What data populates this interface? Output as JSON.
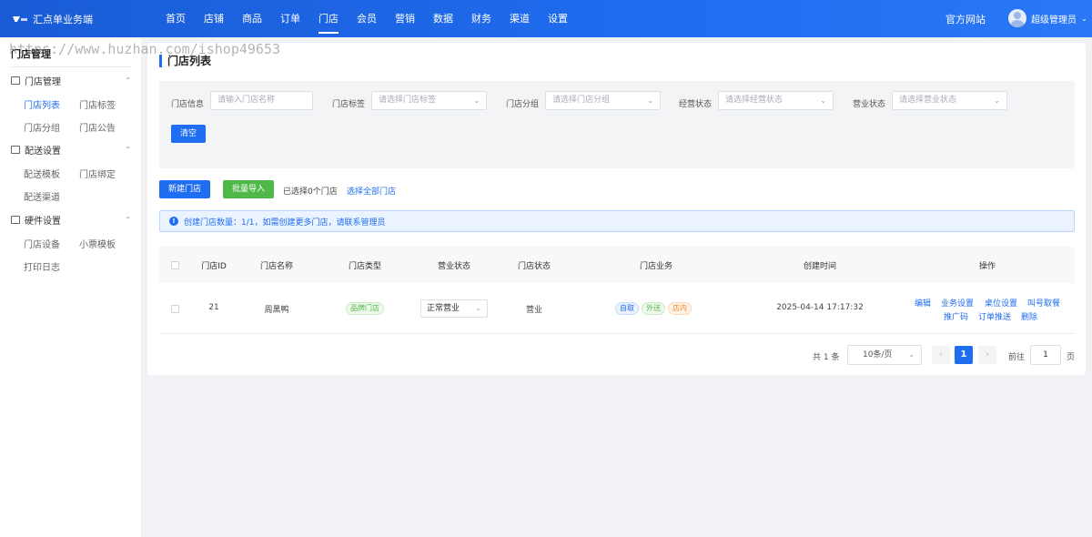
{
  "app": {
    "title": "汇点单业务端"
  },
  "top_nav": {
    "items": [
      "首页",
      "店铺",
      "商品",
      "订单",
      "门店",
      "会员",
      "营销",
      "数据",
      "财务",
      "渠道",
      "设置"
    ],
    "active": "门店"
  },
  "header": {
    "official_site": "官方网站",
    "user_name": "超级管理员"
  },
  "watermark": "https://www.huzhan.com/ishop49653",
  "sidebar": {
    "title": "门店管理",
    "groups": [
      {
        "label": "门店管理",
        "items": [
          "门店列表",
          "门店标签",
          "门店分组",
          "门店公告"
        ]
      },
      {
        "label": "配送设置",
        "items": [
          "配送模板",
          "门店绑定",
          "配送渠道"
        ]
      },
      {
        "label": "硬件设置",
        "items": [
          "门店设备",
          "小票模板",
          "打印日志"
        ]
      }
    ],
    "active_item": "门店列表"
  },
  "page": {
    "title": "门店列表"
  },
  "filters": {
    "store_info": {
      "label": "门店信息",
      "placeholder": "请输入门店名称"
    },
    "store_tag": {
      "label": "门店标签",
      "placeholder": "请选择门店标签"
    },
    "store_group": {
      "label": "门店分组",
      "placeholder": "请选择门店分组"
    },
    "operate_status": {
      "label": "经营状态",
      "placeholder": "请选择经营状态"
    },
    "business_status": {
      "label": "营业状态",
      "placeholder": "请选择营业状态"
    },
    "clear_label": "清空"
  },
  "actions": {
    "new_store": "新建门店",
    "batch_import": "批量导入",
    "selected_text": "已选择0个门店",
    "select_all": "选择全部门店"
  },
  "notice": {
    "text": "创建门店数量：1/1，如需创建更多门店，请联系管理员"
  },
  "table": {
    "columns": [
      "门店ID",
      "门店名称",
      "门店类型",
      "营业状态",
      "门店状态",
      "门店业务",
      "创建时间",
      "操作"
    ],
    "rows": [
      {
        "id": "21",
        "name": "周黑鸭",
        "type": "品牌门店",
        "business_status": "正常营业",
        "store_status": "营业",
        "services": [
          "自取",
          "外送",
          "店内"
        ],
        "created": "2025-04-14 17:17:32",
        "ops": [
          "编辑",
          "业务设置",
          "桌位设置",
          "叫号取餐",
          "推广码",
          "订单推送",
          "删除"
        ]
      }
    ]
  },
  "pagination": {
    "total": "共 1 条",
    "page_size": "10条/页",
    "current": "1",
    "goto_label": "前往",
    "goto_value": "1",
    "unit": "页"
  },
  "colors": {
    "primary": "#1f6df0",
    "success": "#4fb848",
    "warning": "#f08a24"
  }
}
